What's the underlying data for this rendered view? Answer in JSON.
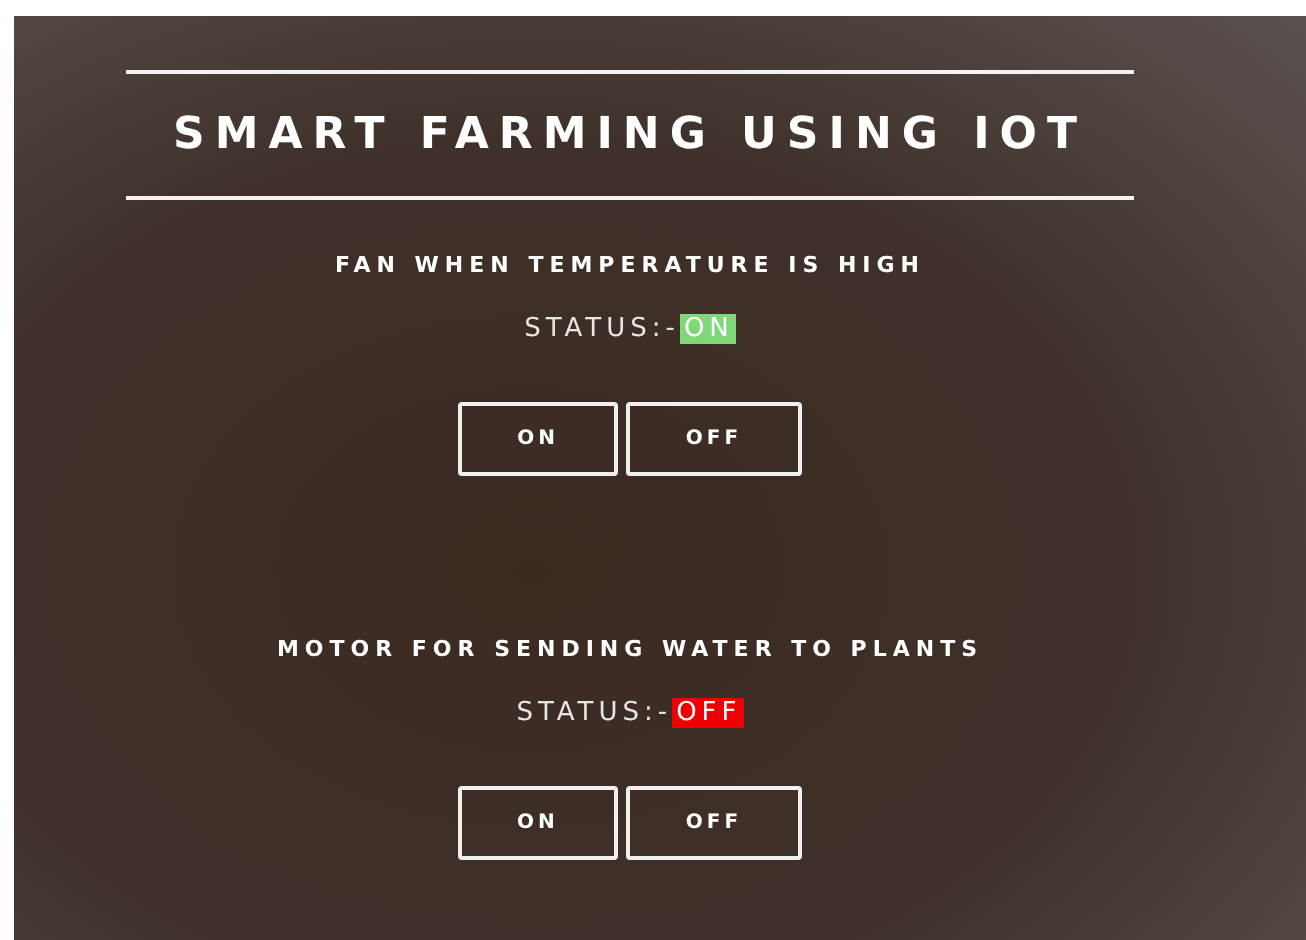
{
  "title": "SMART FARMING USING IOT",
  "devices": [
    {
      "name": "FAN WHEN TEMPERATURE IS HIGH",
      "status_label": "STATUS:-",
      "status_value": "ON",
      "on": true,
      "buttons": [
        "ON",
        "OFF"
      ]
    },
    {
      "name": "MOTOR FOR SENDING WATER TO PLANTS",
      "status_label": "STATUS:-",
      "status_value": "OFF",
      "on": false,
      "buttons": [
        "ON",
        "OFF"
      ]
    }
  ]
}
